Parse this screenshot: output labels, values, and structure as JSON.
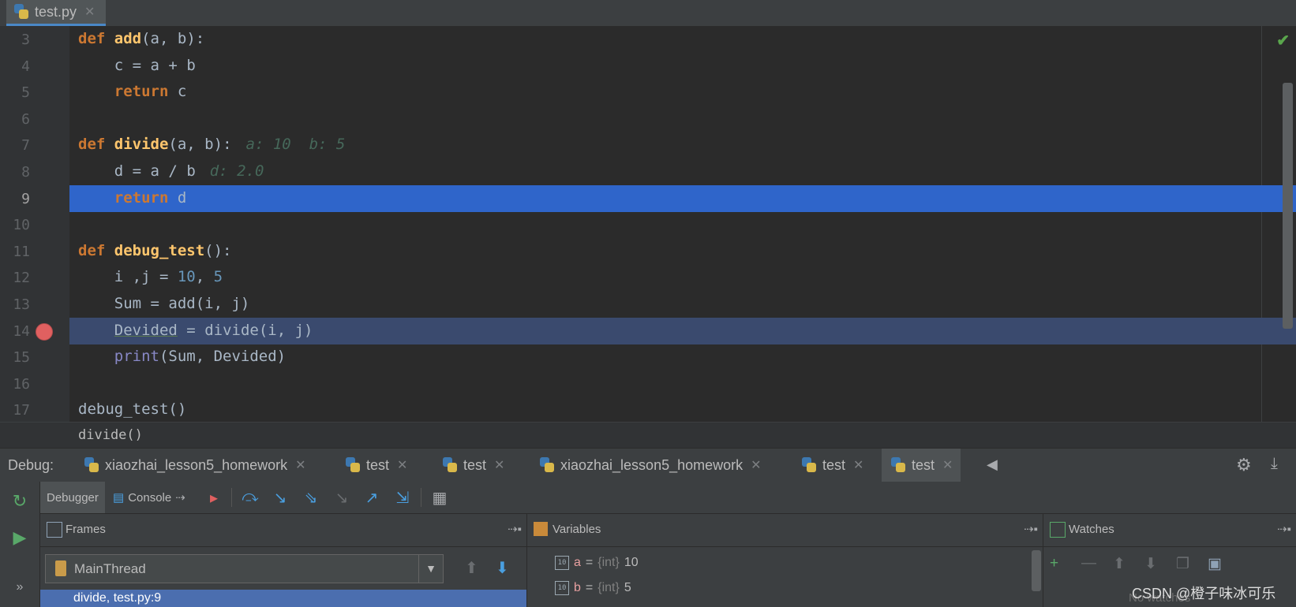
{
  "editor_tab": {
    "filename": "test.py"
  },
  "code_lines": [
    {
      "num": "3",
      "tokens": [
        [
          "kw",
          "def "
        ],
        [
          "fn",
          "add"
        ],
        [
          "p",
          "("
        ],
        [
          "t",
          "a, b"
        ],
        [
          "p",
          "):"
        ]
      ]
    },
    {
      "num": "4",
      "tokens": [
        [
          "t",
          "    c "
        ],
        [
          "p",
          "="
        ],
        [
          "t",
          " a "
        ],
        [
          "p",
          "+"
        ],
        [
          "t",
          " b"
        ]
      ]
    },
    {
      "num": "5",
      "tokens": [
        [
          "t",
          "    "
        ],
        [
          "kw",
          "return"
        ],
        [
          "t",
          " c"
        ]
      ]
    },
    {
      "num": "6",
      "tokens": []
    },
    {
      "num": "7",
      "tokens": [
        [
          "kw",
          "def "
        ],
        [
          "fn",
          "divide"
        ],
        [
          "p",
          "("
        ],
        [
          "t",
          "a, b"
        ],
        [
          "p",
          "):"
        ]
      ],
      "hint": "a: 10  b: 5"
    },
    {
      "num": "8",
      "tokens": [
        [
          "t",
          "    d "
        ],
        [
          "p",
          "="
        ],
        [
          "t",
          " a "
        ],
        [
          "p",
          "/"
        ],
        [
          "t",
          " b"
        ]
      ],
      "hint": "d: 2.0"
    },
    {
      "num": "9",
      "tokens": [
        [
          "t",
          "    "
        ],
        [
          "kw",
          "return"
        ],
        [
          "t",
          " d"
        ]
      ]
    },
    {
      "num": "10",
      "tokens": []
    },
    {
      "num": "11",
      "tokens": [
        [
          "kw",
          "def "
        ],
        [
          "fn",
          "debug_test"
        ],
        [
          "p",
          "():"
        ]
      ]
    },
    {
      "num": "12",
      "tokens": [
        [
          "t",
          "    i ,j "
        ],
        [
          "p",
          "="
        ],
        [
          "num",
          " 10"
        ],
        [
          "t",
          ", "
        ],
        [
          "num",
          "5"
        ]
      ]
    },
    {
      "num": "13",
      "tokens": [
        [
          "t",
          "    Sum "
        ],
        [
          "p",
          "="
        ],
        [
          "t",
          " add(i, j)"
        ]
      ]
    },
    {
      "num": "14",
      "tokens": [
        [
          "t",
          "    "
        ],
        [
          "u",
          "Devided"
        ],
        [
          "t",
          " "
        ],
        [
          "p",
          "="
        ],
        [
          "t",
          " divide(i, j)"
        ]
      ]
    },
    {
      "num": "15",
      "tokens": [
        [
          "t",
          "    "
        ],
        [
          "builtin",
          "print"
        ],
        [
          "t",
          "(Sum, Devided)"
        ]
      ]
    },
    {
      "num": "16",
      "tokens": []
    },
    {
      "num": "17",
      "tokens": [
        [
          "t",
          "debug_test()"
        ]
      ]
    }
  ],
  "breadcrumb": "divide()",
  "debug": {
    "label": "Debug:",
    "tabs": [
      "xiaozhai_lesson5_homework",
      "test",
      "test",
      "xiaozhai_lesson5_homework",
      "test",
      "test"
    ],
    "subtabs": {
      "debugger": "Debugger",
      "console": "Console"
    }
  },
  "frames": {
    "title": "Frames",
    "thread": "MainThread",
    "selected_frame": "divide, test.py:9"
  },
  "variables": {
    "title": "Variables",
    "items": [
      {
        "name": "a",
        "eq": "=",
        "type": "{int}",
        "value": "10"
      },
      {
        "name": "b",
        "eq": "=",
        "type": "{int}",
        "value": "5"
      }
    ]
  },
  "watches": {
    "title": "Watches",
    "empty_text": "No watches"
  },
  "watermark": "CSDN @橙子味冰可乐",
  "colors": {
    "exec_line": "#2f65ca",
    "breakpoint_line": "#3a4a6e",
    "breakpoint": "#e06060",
    "selected_frame": "#4b6eaf"
  },
  "icons": [
    "python-file-icon",
    "breakpoint-icon",
    "rerun-icon",
    "resume-icon",
    "gear-icon",
    "step-over-icon",
    "step-into-icon",
    "step-out-icon"
  ]
}
